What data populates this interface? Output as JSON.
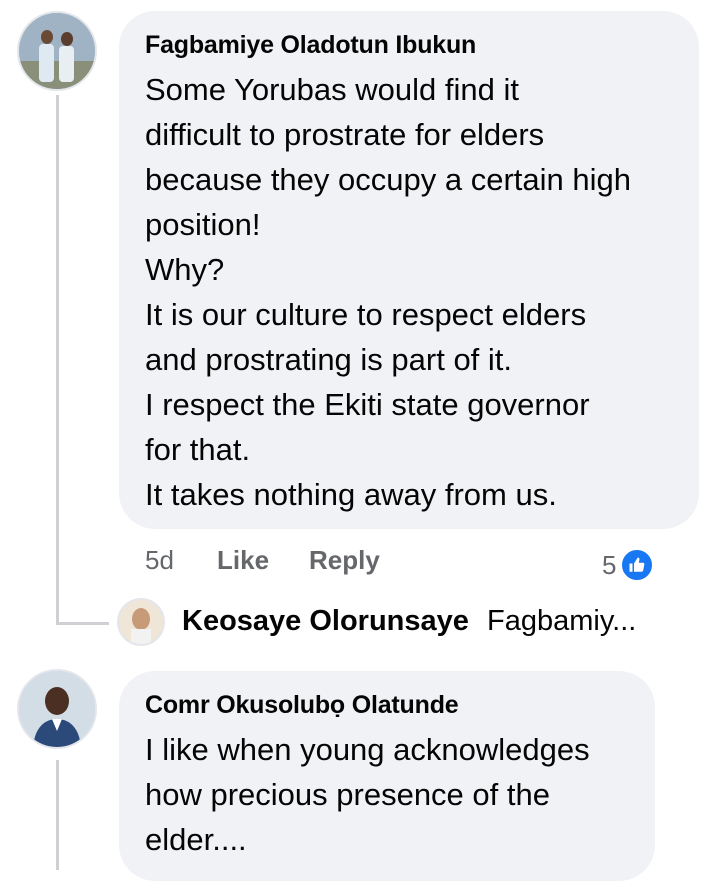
{
  "comments": [
    {
      "author": "Fagbamiye Oladotun Ibukun",
      "text": "Some Yorubas would find it\ndifficult to prostrate for elders\nbecause they occupy a certain high\nposition!\nWhy?\nIt is our culture to respect elders\nand prostrating is part of it.\nI respect the Ekiti state governor\nfor that.\nIt takes nothing away from us.",
      "time": "5d",
      "like_label": "Like",
      "reply_label": "Reply",
      "reaction_count": "5",
      "reaction_icon": "like-icon",
      "reply_preview": {
        "author": "Keosaye Olorunsaye",
        "snippet": "Fagbamiy..."
      }
    },
    {
      "author": "Comr Okusolubọ Olatunde",
      "text": "I like when young acknowledges\nhow precious presence of the\nelder...."
    }
  ],
  "colors": {
    "bubble": "#f0f2f5",
    "meta": "#65676b",
    "like_blue": "#1877f2",
    "thread_line": "#ced0d4"
  }
}
